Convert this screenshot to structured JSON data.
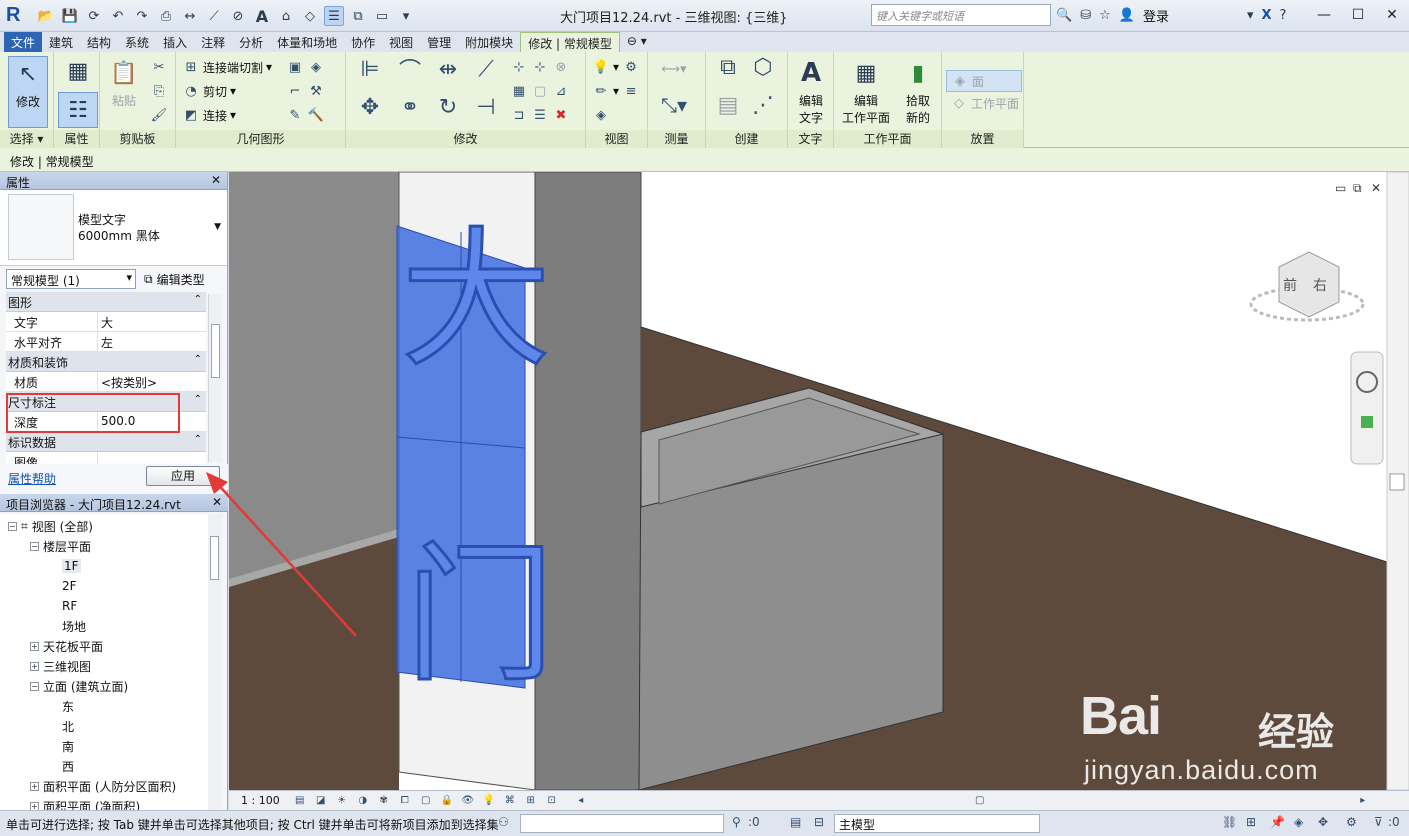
{
  "titlebar": {
    "app_logo": "R",
    "doc_title": "大门项目12.24.rvt - 三维视图: {三维}",
    "search_placeholder": "键入关键字或短语",
    "login_label": "登录",
    "qat_icons": [
      "open-icon",
      "save-icon",
      "sync-icon",
      "undo-icon",
      "redo-icon",
      "print-icon",
      "measure-icon",
      "dimension-icon",
      "tag-icon",
      "text-icon",
      "3d-view-icon",
      "section-icon",
      "thin-lines-icon",
      "close-hidden-icon",
      "switch-windows-icon",
      "customize-icon"
    ]
  },
  "tabs": [
    "文件",
    "建筑",
    "结构",
    "系统",
    "插入",
    "注释",
    "分析",
    "体量和场地",
    "协作",
    "视图",
    "管理",
    "附加模块",
    "修改 | 常规模型"
  ],
  "active_tab_index": 12,
  "ribbon": {
    "select_panel": {
      "modify_label": "修改",
      "label": "选择 ▾"
    },
    "properties_panel": {
      "label": "属性"
    },
    "clipboard_panel": {
      "paste_label": "粘贴",
      "label": "剪贴板"
    },
    "geometry_panel": {
      "join_cut_label": "连接端切割",
      "cut_label": "剪切",
      "join_label": "连接",
      "label": "几何图形"
    },
    "modify_panel": {
      "label": "修改"
    },
    "view_panel": {
      "label": "视图"
    },
    "measure_panel": {
      "label": "测量"
    },
    "create_panel": {
      "label": "创建"
    },
    "text_panel": {
      "edit_text_line1": "编辑",
      "edit_text_line2": "文字",
      "label": "文字"
    },
    "workplane_panel": {
      "edit_wp_line1": "编辑",
      "edit_wp_line2": "工作平面",
      "pick_new_line1": "拾取",
      "pick_new_line2": "新的",
      "label": "工作平面"
    },
    "place_panel": {
      "face_label": "面",
      "workplane_label": "工作平面",
      "label": "放置"
    }
  },
  "context_bar": "修改 | 常规模型",
  "properties": {
    "title": "属性",
    "type_name_line1": "模型文字",
    "type_name_line2": "6000mm 黑体",
    "instance_select": "常规模型 (1)",
    "edit_type": "编辑类型",
    "groups": [
      {
        "name": "图形",
        "rows": [
          {
            "key": "文字",
            "value": "大"
          },
          {
            "key": "水平对齐",
            "value": "左"
          }
        ]
      },
      {
        "name": "材质和装饰",
        "rows": [
          {
            "key": "材质",
            "value": "<按类别>"
          }
        ]
      },
      {
        "name": "尺寸标注",
        "rows": [
          {
            "key": "深度",
            "value": "500.0"
          }
        ]
      },
      {
        "name": "标识数据",
        "rows": [
          {
            "key": "图像",
            "value": ""
          }
        ]
      }
    ],
    "help_link": "属性帮助",
    "apply_button": "应用"
  },
  "project_browser": {
    "title": "项目浏览器 - 大门项目12.24.rvt",
    "nodes": [
      {
        "label": "视图 (全部)",
        "level": 0,
        "toggle": "−"
      },
      {
        "label": "楼层平面",
        "level": 1,
        "toggle": "−"
      },
      {
        "label": "1F",
        "level": 2,
        "toggle": ""
      },
      {
        "label": "2F",
        "level": 2,
        "toggle": ""
      },
      {
        "label": "RF",
        "level": 2,
        "toggle": ""
      },
      {
        "label": "场地",
        "level": 2,
        "toggle": ""
      },
      {
        "label": "天花板平面",
        "level": 1,
        "toggle": "+"
      },
      {
        "label": "三维视图",
        "level": 1,
        "toggle": "+"
      },
      {
        "label": "立面 (建筑立面)",
        "level": 1,
        "toggle": "−"
      },
      {
        "label": "东",
        "level": 2,
        "toggle": ""
      },
      {
        "label": "北",
        "level": 2,
        "toggle": ""
      },
      {
        "label": "南",
        "level": 2,
        "toggle": ""
      },
      {
        "label": "西",
        "level": 2,
        "toggle": ""
      },
      {
        "label": "面积平面 (人防分区面积)",
        "level": 1,
        "toggle": "+"
      },
      {
        "label": "面积平面 (净面积)",
        "level": 1,
        "toggle": "+"
      }
    ],
    "selected_index": 2
  },
  "viewcube": {
    "front": "前",
    "right": "右"
  },
  "model_text": {
    "char1": "大",
    "char2": "门"
  },
  "view_control": {
    "scale": "1 : 100"
  },
  "status": {
    "text": "单击可进行选择; 按 Tab 键并单击可选择其他项目; 按 Ctrl 键并单击可将新项目添加到选择集; 按 Shift 键并单击可取消选择。",
    "filter_count": ":0",
    "model_select": "主模型",
    "filter_count2": ":0"
  },
  "watermark": {
    "brand": "Bai",
    "site": "经验",
    "url": "jingyan.baidu.com"
  },
  "colors": {
    "selection_blue": "#3f6fe0",
    "floor": "#5e4a3c",
    "wall_gray": "#8c8c8c",
    "callout_red": "#e23a36",
    "ribbon_green": "#eaf3de"
  }
}
